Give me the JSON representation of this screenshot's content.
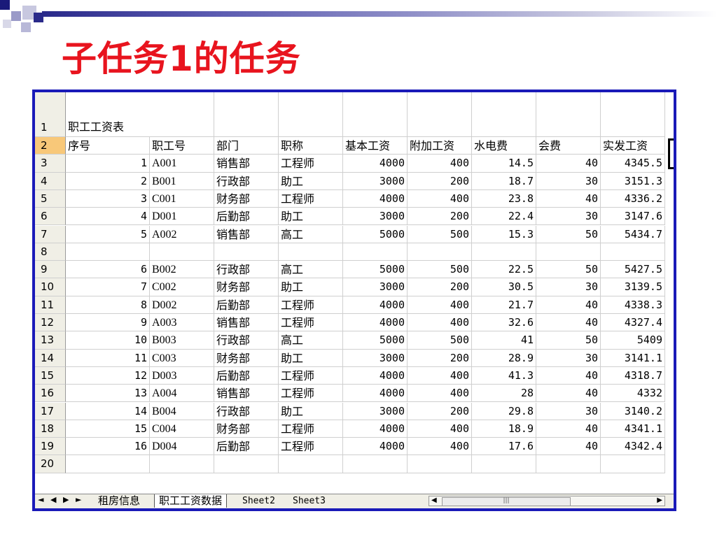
{
  "slide": {
    "title": "子任务1的任务",
    "colors": {
      "title": "#e8141e",
      "frame": "#1a1ab8",
      "selected_row_header": "#f8c879"
    }
  },
  "sheet": {
    "title_row": {
      "num": "1",
      "text": "职工工资表"
    },
    "header_row": {
      "num": "2",
      "cols": [
        "序号",
        "职工号",
        "部门",
        "职称",
        "基本工资",
        "附加工资",
        "水电费",
        "会费",
        "实发工资"
      ]
    },
    "rows": [
      {
        "num": "3",
        "cells": [
          "1",
          "A001",
          "销售部",
          "工程师",
          "4000",
          "400",
          "14.5",
          "40",
          "4345.5"
        ]
      },
      {
        "num": "4",
        "cells": [
          "2",
          "B001",
          "行政部",
          "助工",
          "3000",
          "200",
          "18.7",
          "30",
          "3151.3"
        ]
      },
      {
        "num": "5",
        "cells": [
          "3",
          "C001",
          "财务部",
          "工程师",
          "4000",
          "400",
          "23.8",
          "40",
          "4336.2"
        ]
      },
      {
        "num": "6",
        "cells": [
          "4",
          "D001",
          "后勤部",
          "助工",
          "3000",
          "200",
          "22.4",
          "30",
          "3147.6"
        ]
      },
      {
        "num": "7",
        "cells": [
          "5",
          "A002",
          "销售部",
          "高工",
          "5000",
          "500",
          "15.3",
          "50",
          "5434.7"
        ]
      },
      {
        "num": "8",
        "cells": [
          "",
          "",
          "",
          "",
          "",
          "",
          "",
          "",
          ""
        ]
      },
      {
        "num": "9",
        "cells": [
          "6",
          "B002",
          "行政部",
          "高工",
          "5000",
          "500",
          "22.5",
          "50",
          "5427.5"
        ]
      },
      {
        "num": "10",
        "cells": [
          "7",
          "C002",
          "财务部",
          "助工",
          "3000",
          "200",
          "30.5",
          "30",
          "3139.5"
        ]
      },
      {
        "num": "11",
        "cells": [
          "8",
          "D002",
          "后勤部",
          "工程师",
          "4000",
          "400",
          "21.7",
          "40",
          "4338.3"
        ]
      },
      {
        "num": "12",
        "cells": [
          "9",
          "A003",
          "销售部",
          "工程师",
          "4000",
          "400",
          "32.6",
          "40",
          "4327.4"
        ]
      },
      {
        "num": "13",
        "cells": [
          "10",
          "B003",
          "行政部",
          "高工",
          "5000",
          "500",
          "41",
          "50",
          "5409"
        ]
      },
      {
        "num": "14",
        "cells": [
          "11",
          "C003",
          "财务部",
          "助工",
          "3000",
          "200",
          "28.9",
          "30",
          "3141.1"
        ]
      },
      {
        "num": "15",
        "cells": [
          "12",
          "D003",
          "后勤部",
          "工程师",
          "4000",
          "400",
          "41.3",
          "40",
          "4318.7"
        ]
      },
      {
        "num": "16",
        "cells": [
          "13",
          "A004",
          "销售部",
          "工程师",
          "4000",
          "400",
          "28",
          "40",
          "4332"
        ]
      },
      {
        "num": "17",
        "cells": [
          "14",
          "B004",
          "行政部",
          "助工",
          "3000",
          "200",
          "29.8",
          "30",
          "3140.2"
        ]
      },
      {
        "num": "18",
        "cells": [
          "15",
          "C004",
          "财务部",
          "工程师",
          "4000",
          "400",
          "18.9",
          "40",
          "4341.1"
        ]
      },
      {
        "num": "19",
        "cells": [
          "16",
          "D004",
          "后勤部",
          "工程师",
          "4000",
          "400",
          "17.6",
          "40",
          "4342.4"
        ]
      },
      {
        "num": "20",
        "cells": [
          "",
          "",
          "",
          "",
          "",
          "",
          "",
          "",
          ""
        ]
      }
    ],
    "tabs": [
      "租房信息",
      "职工工资数据",
      "Sheet2",
      "Sheet3"
    ],
    "nav_icons": [
      "first-sheet-icon",
      "prev-sheet-icon",
      "next-sheet-icon",
      "last-sheet-icon"
    ],
    "scroll_thumb": "|||"
  }
}
